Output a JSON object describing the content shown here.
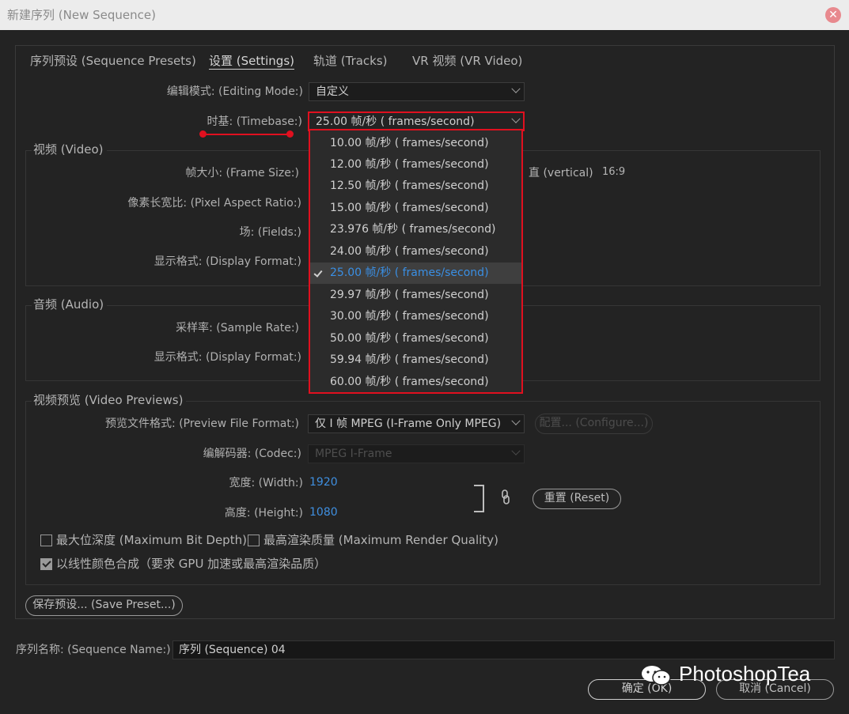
{
  "window": {
    "title": "新建序列 (New Sequence)",
    "close_glyph": "✕"
  },
  "tabs": [
    {
      "label": "序列预设 (Sequence Presets)"
    },
    {
      "label": "设置 (Settings)"
    },
    {
      "label": "轨道 (Tracks)"
    },
    {
      "label": "VR 视频 (VR Video)"
    }
  ],
  "settings": {
    "editing_mode_label": "编辑模式: (Editing Mode:)",
    "editing_mode_value": "自定义",
    "timebase_label": "时基: (Timebase:)",
    "timebase_value": "25.00  帧/秒 ( frames/second)"
  },
  "video": {
    "title": "视频 (Video)",
    "frame_size_label": "帧大小: (Frame Size:)",
    "vertical_label": "直 (vertical)",
    "aspect": "16:9",
    "pixel_aspect_label": "像素长宽比: (Pixel Aspect Ratio:)",
    "fields_label": "场: (Fields:)",
    "display_format_label": "显示格式: (Display Format:)"
  },
  "audio": {
    "title": "音频 (Audio)",
    "sample_rate_label": "采样率: (Sample Rate:)",
    "display_format_label": "显示格式: (Display Format:)"
  },
  "previews": {
    "title": "视频预览 (Video Previews)",
    "file_format_label": "预览文件格式: (Preview File Format:)",
    "file_format_value": "仅 I 帧 MPEG (I-Frame Only MPEG)",
    "configure_label": "配置... (Configure...)",
    "codec_label": "编解码器: (Codec:)",
    "codec_value": "MPEG I-Frame",
    "width_label": "宽度: (Width:)",
    "width_value": "1920",
    "height_label": "高度: (Height:)",
    "height_value": "1080",
    "reset_label": "重置 (Reset)",
    "max_bit_depth_label": "最大位深度 (Maximum Bit Depth)",
    "max_bit_depth_checked": false,
    "max_render_quality_label": "最高渲染质量 (Maximum Render Quality)",
    "max_render_quality_checked": false,
    "linear_color_label": "以线性颜色合成（要求 GPU 加速或最高渲染品质）",
    "linear_color_checked": true
  },
  "save_preset_label": "保存预设... (Save Preset...)",
  "sequence_name": {
    "label": "序列名称: (Sequence Name:)",
    "value": "序列 (Sequence) 04"
  },
  "buttons": {
    "ok": "确定 (OK)",
    "cancel": "取消 (Cancel)"
  },
  "watermark": "PhotoshopTea",
  "timebase_dropdown": {
    "selected": "25.00  帧/秒 ( frames/second)",
    "options": [
      "10.00  帧/秒 ( frames/second)",
      "12.00  帧/秒 ( frames/second)",
      "12.50  帧/秒 ( frames/second)",
      "15.00  帧/秒 ( frames/second)",
      "23.976  帧/秒 ( frames/second)",
      "24.00  帧/秒 ( frames/second)",
      "25.00  帧/秒 ( frames/second)",
      "29.97  帧/秒 ( frames/second)",
      "30.00  帧/秒 ( frames/second)",
      "50.00  帧/秒 ( frames/second)",
      "59.94  帧/秒 ( frames/second)",
      "60.00  帧/秒 ( frames/second)"
    ]
  },
  "colors": {
    "accent_blue": "#3f8fe0",
    "highlight_red": "#e0101f",
    "background": "#232323"
  }
}
